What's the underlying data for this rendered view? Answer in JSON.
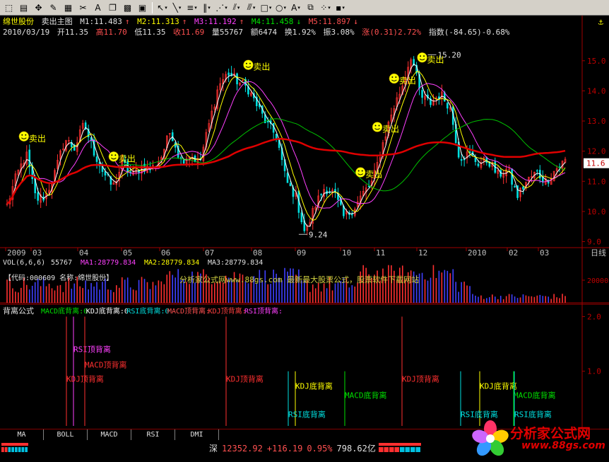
{
  "toolbar": {
    "icons": [
      "select-icon",
      "chart-icon",
      "crosshair-icon",
      "draw-icon",
      "grid-icon",
      "cut-icon",
      "text-icon",
      "copy-icon",
      "color-icon",
      "save-icon"
    ]
  },
  "header": {
    "stock_name": "绵世股份",
    "formula_name": "卖出主图",
    "m1": "M1:11.483",
    "m2": "M2:11.313",
    "m3": "M3:11.192",
    "m4": "M4:11.458",
    "m5": "M5:11.897",
    "date": "2010/03/19",
    "open": "开11.35",
    "high": "高11.70",
    "low": "低11.35",
    "close": "收11.69",
    "volume": "量55767",
    "amount": "额6474",
    "turnover": "换1.92%",
    "amplitude": "振3.08%",
    "change": "涨(0.31)2.72%",
    "index": "指数(-84.65)-0.68%"
  },
  "colors": {
    "up": "#ff3030",
    "down": "#00e0e0",
    "ma_white": "#ffffff",
    "ma_yellow": "#ffff00",
    "ma_magenta": "#ff40ff",
    "ma_green": "#00c000",
    "ma_red": "#e00000",
    "axis": "#a00000"
  },
  "chart_data": [
    {
      "type": "line",
      "name": "price",
      "y_ticks": [
        "15.0",
        "14.0",
        "13.0",
        "12.0",
        "11.0",
        "10.0",
        "9.0"
      ],
      "ylim": [
        8.8,
        15.7
      ],
      "x_ticks": [
        "2009",
        "03",
        "04",
        "05",
        "06",
        "07",
        "08",
        "09",
        "10",
        "11",
        "12",
        "2010",
        "02",
        "03"
      ],
      "x_end_label": "日线",
      "current_price": "11.6",
      "annotations": [
        "15.20",
        "9.24"
      ],
      "sell_signal_label": "卖出",
      "sell_signal_count": 7,
      "price_path": [
        10.2,
        11.2,
        11.9,
        10.4,
        10.5,
        11.3,
        12.4,
        12.1,
        12.9,
        12.0,
        11.3,
        10.8,
        11.6,
        11.2,
        11.5,
        11.4,
        11.8,
        12.7,
        11.7,
        11.9,
        11.6,
        12.9,
        14.2,
        14.6,
        14.3,
        14.1,
        13.5,
        12.9,
        12.5,
        11.0,
        10.5,
        9.24,
        10.2,
        10.8,
        10.6,
        9.8,
        10.1,
        10.6,
        11.0,
        12.2,
        13.3,
        14.1,
        15.2,
        13.8,
        13.6,
        13.9,
        13.5,
        11.8,
        11.9,
        11.6,
        11.7,
        11.2,
        11.4,
        10.5,
        11.0,
        11.3,
        11.0,
        11.4,
        11.69
      ]
    },
    {
      "type": "bar",
      "name": "volume",
      "label": "VOL(6,6,6)",
      "value": "55767",
      "ma1": "MA1:28779.834",
      "ma2": "MA2:28779.834",
      "ma3": "MA3:28779.834",
      "y_tick": "20000",
      "overlay_text": "【代码:000609 名称:绵世股份】",
      "watermark": "分析家公式网www.88gs.com 最新最大股票公式，股票软件下载网站"
    },
    {
      "type": "bar",
      "name": "divergence",
      "title": "背离公式",
      "labels": [
        "MACD底背离:0",
        "KDJ底背离:0",
        "RSI底背离:0",
        "MACD顶背离:",
        "KDJ顶背离:",
        "RSI顶背离:"
      ],
      "y_ticks": [
        "2.0",
        "1.0"
      ],
      "ylim": [
        0,
        2.2
      ],
      "signals": [
        {
          "text": "RSI顶背离",
          "value": 2.0,
          "kind": "top"
        },
        {
          "text": "MACD顶背离",
          "value": 2.0,
          "kind": "top"
        },
        {
          "text": "KDJ顶背离",
          "value": 2.0,
          "kind": "top"
        },
        {
          "text": "KDJ顶背离",
          "value": 2.0,
          "kind": "top"
        },
        {
          "text": "KDJ顶背离",
          "value": 2.0,
          "kind": "top"
        },
        {
          "text": "KDJ底背离",
          "value": 1.0,
          "kind": "bottom"
        },
        {
          "text": "RSI底背离",
          "value": 1.0,
          "kind": "bottom"
        },
        {
          "text": "MACD底背离",
          "value": 1.0,
          "kind": "bottom"
        },
        {
          "text": "KDJ底背离",
          "value": 1.0,
          "kind": "bottom"
        },
        {
          "text": "MACD底背离",
          "value": 1.0,
          "kind": "bottom"
        },
        {
          "text": "RSI底背离",
          "value": 1.0,
          "kind": "bottom"
        },
        {
          "text": "RSI底背离",
          "value": 1.0,
          "kind": "bottom"
        }
      ]
    }
  ],
  "tabs": [
    "MA",
    "BOLL",
    "MACD",
    "RSI",
    "DMI"
  ],
  "status": {
    "market": "深",
    "index_value": "12352.92",
    "index_change": "+116.19",
    "index_pct": "0.95%",
    "turnover": "798.62亿"
  },
  "logo": {
    "text": "分析家公式网",
    "url": "www.88gs.com"
  }
}
